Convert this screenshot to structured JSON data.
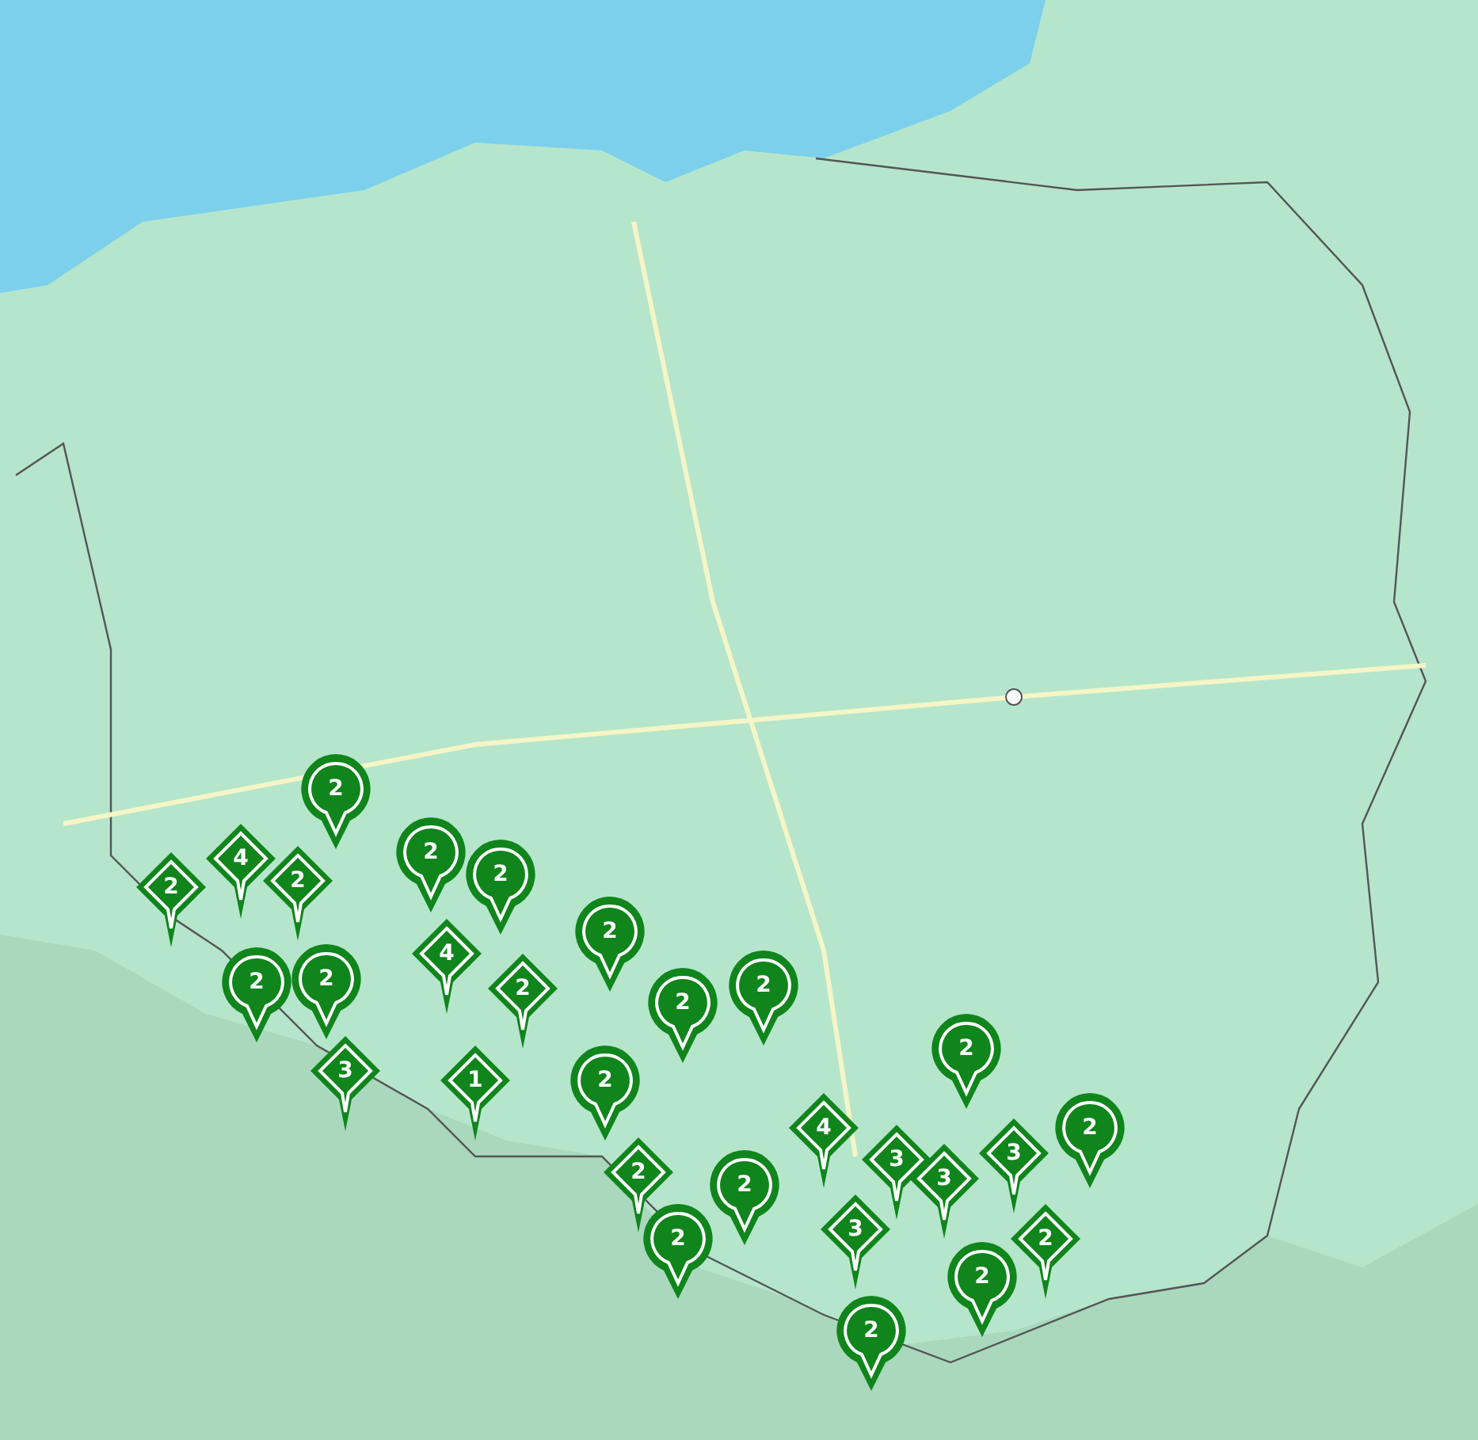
{
  "map": {
    "markers": [
      {
        "kind": "round",
        "count": "2"
      },
      {
        "kind": "diamond",
        "count": "2"
      },
      {
        "kind": "diamond",
        "count": "4"
      },
      {
        "kind": "diamond",
        "count": "2"
      },
      {
        "kind": "round",
        "count": "2"
      },
      {
        "kind": "round",
        "count": "2"
      },
      {
        "kind": "diamond",
        "count": "3"
      },
      {
        "kind": "round",
        "count": "2"
      },
      {
        "kind": "round",
        "count": "2"
      },
      {
        "kind": "diamond",
        "count": "4"
      },
      {
        "kind": "diamond",
        "count": "2"
      },
      {
        "kind": "diamond",
        "count": "1"
      },
      {
        "kind": "round",
        "count": "2"
      },
      {
        "kind": "round",
        "count": "2"
      },
      {
        "kind": "round",
        "count": "2"
      },
      {
        "kind": "round",
        "count": "2"
      },
      {
        "kind": "diamond",
        "count": "2"
      },
      {
        "kind": "round",
        "count": "2"
      },
      {
        "kind": "round",
        "count": "2"
      },
      {
        "kind": "diamond",
        "count": "4"
      },
      {
        "kind": "diamond",
        "count": "3"
      },
      {
        "kind": "diamond",
        "count": "3"
      },
      {
        "kind": "diamond",
        "count": "3"
      },
      {
        "kind": "round",
        "count": "2"
      },
      {
        "kind": "diamond",
        "count": "3"
      },
      {
        "kind": "round",
        "count": "2"
      },
      {
        "kind": "diamond",
        "count": "2"
      },
      {
        "kind": "round",
        "count": "2"
      },
      {
        "kind": "round",
        "count": "2"
      }
    ]
  }
}
